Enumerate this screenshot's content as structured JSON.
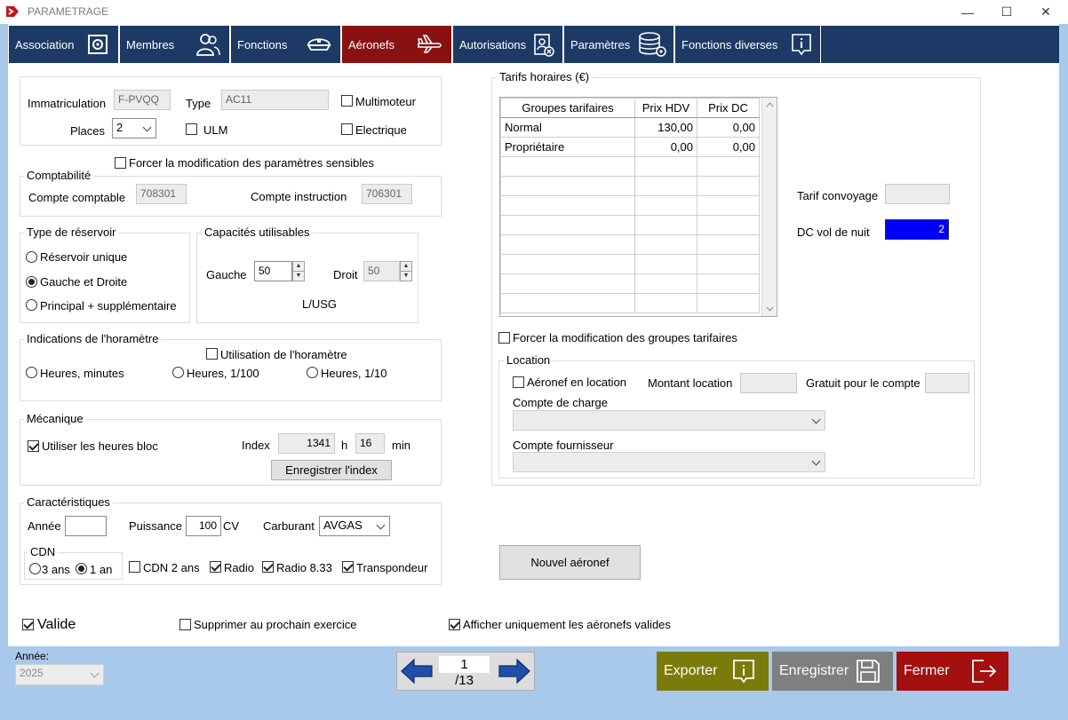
{
  "window": {
    "title": "PARAMETRAGE",
    "minimize": "—",
    "maximize": "☐",
    "close": "✕"
  },
  "tabs": [
    {
      "label": "Association",
      "icon": "gear-icon"
    },
    {
      "label": "Membres",
      "icon": "users-icon"
    },
    {
      "label": "Fonctions",
      "icon": "pilot-cap-icon"
    },
    {
      "label": "Aéronefs",
      "icon": "airplane-icon",
      "active": true
    },
    {
      "label": "Autorisations",
      "icon": "badge-icon"
    },
    {
      "label": "Paramètres",
      "icon": "database-gear-icon"
    },
    {
      "label": "Fonctions diverses",
      "icon": "info-icon"
    }
  ],
  "aircraft": {
    "immat_label": "Immatriculation",
    "immat_value": "F-PVQQ",
    "type_label": "Type",
    "type_value": "AC11",
    "multimoteur_label": "Multimoteur",
    "places_label": "Places",
    "places_value": "2",
    "ulm_label": "ULM",
    "electrique_label": "Electrique"
  },
  "force_sensitive_label": "Forcer la modification des paramètres sensibles",
  "comptabilite": {
    "title": "Comptabilité",
    "compte_label": "Compte comptable",
    "compte_value": "708301",
    "instruction_label": "Compte  instruction",
    "instruction_value": "706301"
  },
  "reservoir": {
    "title": "Type de réservoir",
    "options": [
      "Réservoir unique",
      "Gauche et Droite",
      "Principal + supplémentaire"
    ],
    "selected": "Gauche et Droite"
  },
  "capacites": {
    "title": "Capacités utilisables",
    "gauche_label": "Gauche",
    "gauche_value": "50",
    "droit_label": "Droit",
    "droit_value": "50",
    "unit": "L/USG"
  },
  "horametre": {
    "title": "Indications de l'horamètre",
    "use_label": "Utilisation de l'horamètre",
    "options": [
      "Heures, minutes",
      "Heures, 1/100",
      "Heures, 1/10"
    ]
  },
  "mecanique": {
    "title": "Mécanique",
    "bloc_label": "Utiliser les heures bloc",
    "index_label": "Index",
    "index_hours": "1341",
    "h_label": "h",
    "index_minutes": "16",
    "min_label": "min",
    "save_index_label": "Enregistrer l'index"
  },
  "caracteristiques": {
    "title": "Caractéristiques",
    "annee_label": "Année",
    "annee_value": "",
    "puissance_label": "Puissance",
    "puissance_value": "100",
    "cv_label": "CV",
    "carburant_label": "Carburant",
    "carburant_value": "AVGAS",
    "cdn_title": "CDN",
    "cdn_3_label": "3 ans",
    "cdn_1_label": "1 an",
    "cdn2_label": "CDN 2 ans",
    "radio_label": "Radio",
    "radio833_label": "Radio 8.33",
    "transpondeur_label": "Transpondeur"
  },
  "tarifs": {
    "title": "Tarifs horaires (€)",
    "columns": [
      "Groupes tarifaires",
      "Prix HDV",
      "Prix DC"
    ],
    "rows": [
      [
        "Normal",
        "130,00",
        "0,00"
      ],
      [
        "Propriétaire",
        "0,00",
        "0,00"
      ]
    ],
    "convoyage_label": "Tarif convoyage",
    "convoyage_value": "",
    "dc_nuit_label": "DC vol de nuit",
    "dc_nuit_value": "2"
  },
  "force_groups_label": "Forcer la modification des groupes tarifaires",
  "location": {
    "title": "Location",
    "en_location_label": "Aéronef en location",
    "montant_label": "Montant location",
    "montant_value": "",
    "gratuit_label": "Gratuit pour le compte",
    "gratuit_value": "",
    "charge_label": "Compte de charge",
    "fournisseur_label": "Compte fournisseur"
  },
  "nouvel_aeronef_label": "Nouvel aéronef",
  "bottom": {
    "valide_label": "Valide",
    "supprimer_label": "Supprimer au prochain exercice",
    "afficher_label": "Afficher uniquement les aéronefs valides"
  },
  "footer": {
    "annee_label": "Année:",
    "annee_value": "2025",
    "page_current": "1",
    "page_total": "/13",
    "exporter_label": "Exporter",
    "enregistrer_label": "Enregistrer",
    "fermer_label": "Fermer"
  },
  "colors": {
    "tab_blue": "#1d3a66",
    "tab_active": "#8a1111",
    "export_bg": "#7b7b0c",
    "save_bg": "#7f7f7f",
    "close_bg": "#a40f0f",
    "dc_nuit_bg": "#0000ff",
    "window_bg": "#a9c9ea"
  }
}
